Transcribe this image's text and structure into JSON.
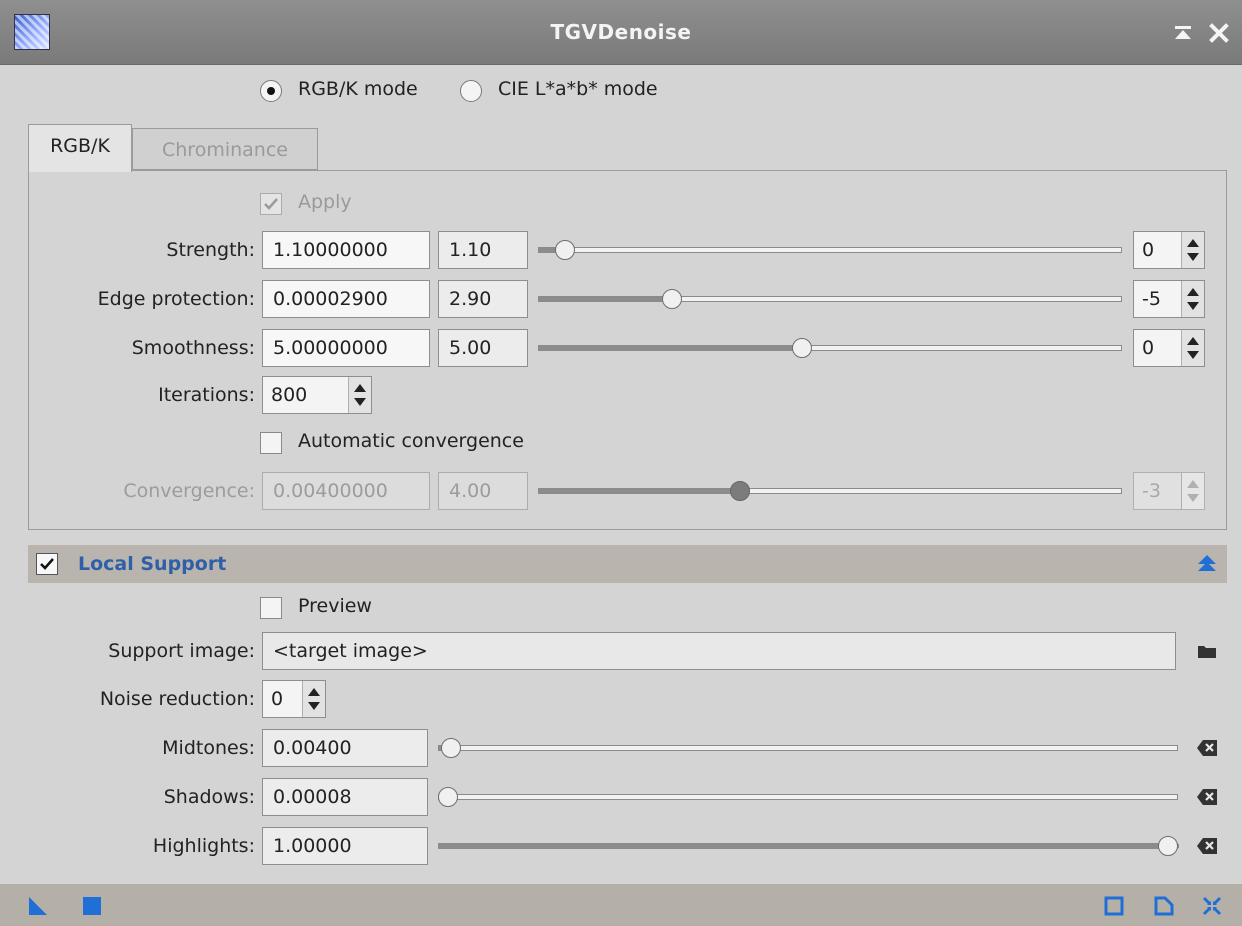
{
  "window": {
    "title": "TGVDenoise"
  },
  "mode": {
    "options": [
      "RGB/K mode",
      "CIE L*a*b* mode"
    ],
    "selected": "RGB/K mode"
  },
  "tabs": [
    {
      "label": "RGB/K",
      "active": true
    },
    {
      "label": "Chrominance",
      "active": false
    }
  ],
  "rgbk": {
    "apply_label": "Apply",
    "apply_checked": true,
    "apply_enabled": false,
    "strength": {
      "label": "Strength:",
      "value": "1.10000000",
      "mantissa": "1.10",
      "exponent": "0",
      "slider_fraction": 0.03
    },
    "edge_protection": {
      "label": "Edge protection:",
      "value": "0.00002900",
      "mantissa": "2.90",
      "exponent": "-5",
      "slider_fraction": 0.22
    },
    "smoothness": {
      "label": "Smoothness:",
      "value": "5.00000000",
      "mantissa": "5.00",
      "exponent": "0",
      "slider_fraction": 0.45
    },
    "iterations": {
      "label": "Iterations:",
      "value": "800"
    },
    "auto_convergence": {
      "label": "Automatic convergence",
      "checked": false
    },
    "convergence": {
      "label": "Convergence:",
      "value": "0.00400000",
      "mantissa": "4.00",
      "exponent": "-3",
      "slider_fraction": 0.34,
      "enabled": false
    }
  },
  "local_support": {
    "title": "Local Support",
    "enabled": true,
    "preview": {
      "label": "Preview",
      "checked": false
    },
    "support_image": {
      "label": "Support image:",
      "value": "<target image>"
    },
    "noise_reduction": {
      "label": "Noise reduction:",
      "value": "0"
    },
    "midtones": {
      "label": "Midtones:",
      "value": "0.00400",
      "slider_fraction": 0.004
    },
    "shadows": {
      "label": "Shadows:",
      "value": "0.00008",
      "slider_fraction": 0.0
    },
    "highlights": {
      "label": "Highlights:",
      "value": "1.00000",
      "slider_fraction": 1.0
    }
  },
  "icons": {
    "title_bar": [
      "app-icon",
      "shade-icon",
      "close-icon"
    ],
    "section": [
      "checkbox-icon",
      "collapse-icon"
    ],
    "support_image": "folder-icon",
    "reset": "clear-icon",
    "bottom_left": [
      "new-instance-icon",
      "apply-global-icon"
    ],
    "bottom_right": [
      "browse-documentation-icon",
      "reset-icon",
      "preview-icon"
    ]
  },
  "colors": {
    "accent": "#2f5fa8",
    "icon_blue": "#1f6fd6",
    "section_header": "#b9b5ae",
    "title_bar": "#858585"
  }
}
